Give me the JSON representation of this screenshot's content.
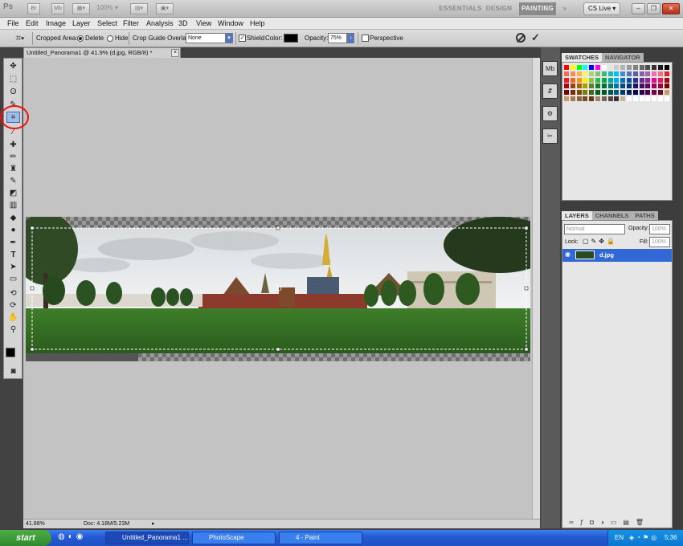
{
  "appbar": {
    "logo": "Ps",
    "zoom_value": "100%",
    "workspaces": [
      "ESSENTIALS",
      "DESIGN",
      "PAINTING"
    ],
    "active_workspace": "PAINTING",
    "more": "»",
    "cs_live": "CS Live"
  },
  "menu": [
    "File",
    "Edit",
    "Image",
    "Layer",
    "Select",
    "Filter",
    "Analysis",
    "3D",
    "View",
    "Window",
    "Help"
  ],
  "options": {
    "cropped_area_label": "Cropped Area:",
    "delete_label": "Delete",
    "hide_label": "Hide",
    "overlay_label": "Crop Guide Overlay:",
    "overlay_value": "None",
    "shield_label": "Shield",
    "color_label": "Color:",
    "opacity_label": "Opacity:",
    "opacity_value": "75%",
    "perspective_label": "Perspective"
  },
  "document": {
    "tab_title": "Untitled_Panorama1 @ 41.9% (d.jpg, RGB/8) *",
    "zoom_status": "41.88%",
    "doc_status": "Doc: 4.18M/5.23M"
  },
  "panels": {
    "swatches_tab": "SWATCHES",
    "navigator_tab": "NAVIGATOR",
    "layers_tab": "LAYERS",
    "channels_tab": "CHANNELS",
    "paths_tab": "PATHS",
    "blend_mode": "Normal",
    "opacity_label": "Opacity:",
    "opacity_value": "100%",
    "lock_label": "Lock:",
    "fill_label": "Fill:",
    "fill_value": "100%",
    "layer_name": "d.jpg"
  },
  "taskbar": {
    "start": "start",
    "tasks": [
      "Untitled_Panorama1 ...",
      "PhotoScape",
      "4 - Paint"
    ],
    "lang": "EN",
    "time": "5:36"
  },
  "colors": {
    "accent_blue": "#2f5fc2",
    "highlight_red": "#e11111",
    "canvas_gray": "#c3c3c3"
  }
}
